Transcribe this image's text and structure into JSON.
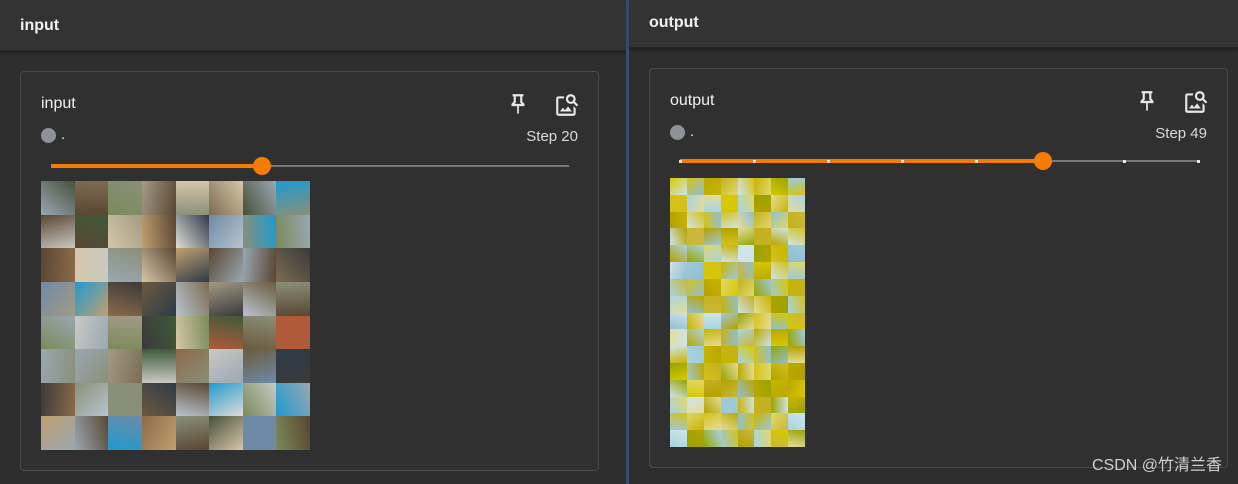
{
  "panes": {
    "left": {
      "header_title": "input",
      "card": {
        "title": "input",
        "run_label": ".",
        "step_text": "Step 20",
        "slider": {
          "current_step": 20,
          "max_step": 49,
          "ticks": []
        },
        "image_grid": {
          "cols": 8,
          "rows": 8,
          "style": "natural"
        }
      }
    },
    "right": {
      "header_title": "output",
      "card": {
        "title": "output",
        "run_label": ".",
        "step_text": "Step 49",
        "slider": {
          "current_step": 49,
          "max_step": 70,
          "ticks": [
            0,
            10,
            20,
            30,
            40,
            50,
            60,
            70
          ]
        },
        "image_grid": {
          "cols": 8,
          "rows": 16,
          "style": "noisy"
        }
      }
    }
  },
  "icons": {
    "pin": "pin-icon",
    "image_search": "image-search-icon"
  },
  "colors": {
    "accent": "#f57c00",
    "run_dot": "#8e9198",
    "divider": "#3a4f6e"
  },
  "watermark": "CSDN @竹清兰香"
}
